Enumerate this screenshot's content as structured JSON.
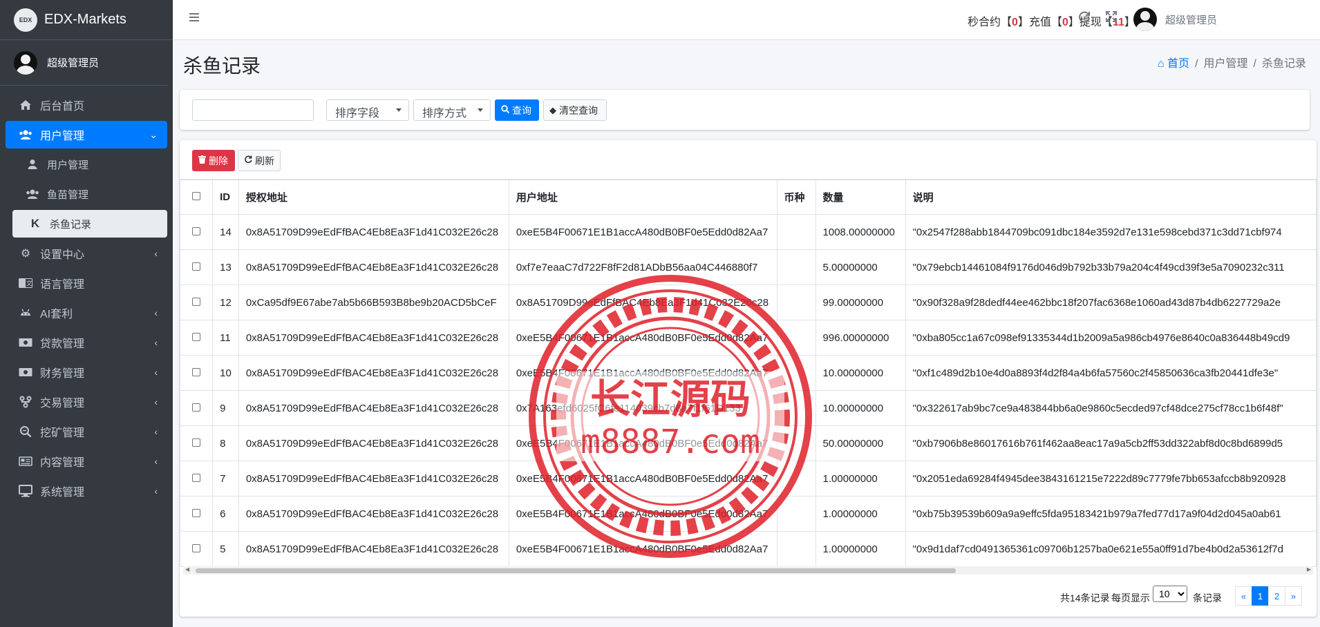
{
  "brand": {
    "logo_text": "EDX",
    "name": "EDX-Markets"
  },
  "sidebar": {
    "user_name": "超级管理员",
    "items": [
      {
        "label": "后台首页",
        "icon": "home-icon"
      },
      {
        "label": "用户管理",
        "icon": "users-icon",
        "active": true
      },
      {
        "label": "用户管理",
        "icon": "user-icon",
        "sub": true
      },
      {
        "label": "鱼苗管理",
        "icon": "users-icon",
        "sub": true
      },
      {
        "label": "杀鱼记录",
        "icon": "k-icon",
        "sub": true,
        "current": true
      },
      {
        "label": "设置中心",
        "icon": "gears-icon"
      },
      {
        "label": "语言管理",
        "icon": "language-icon"
      },
      {
        "label": "AI套利",
        "icon": "android-icon"
      },
      {
        "label": "贷款管理",
        "icon": "money-icon"
      },
      {
        "label": "财务管理",
        "icon": "money-icon"
      },
      {
        "label": "交易管理",
        "icon": "exchange-icon"
      },
      {
        "label": "挖矿管理",
        "icon": "search-icon"
      },
      {
        "label": "内容管理",
        "icon": "newspaper-icon"
      },
      {
        "label": "系统管理",
        "icon": "desktop-icon"
      }
    ]
  },
  "header": {
    "seconds_label": "秒合约",
    "seconds_count": "0",
    "recharge_label": "充值",
    "recharge_count": "0",
    "withdraw_label": "提现",
    "withdraw_count": "11",
    "user_name": "超级管理员"
  },
  "page": {
    "title": "杀鱼记录",
    "breadcrumb": [
      "首页",
      "用户管理",
      "杀鱼记录"
    ]
  },
  "search": {
    "input_value": "",
    "sort_field": "排序字段",
    "sort_order": "排序方式",
    "query_label": "查询",
    "clear_label": "清空查询"
  },
  "toolbar": {
    "delete_label": "删除",
    "refresh_label": "刷新"
  },
  "table": {
    "columns": [
      "ID",
      "授权地址",
      "用户地址",
      "币种",
      "数量",
      "说明"
    ],
    "rows": [
      {
        "id": "14",
        "auth": "0x8A51709D99eEdFfBAC4Eb8Ea3F1d41C032E26c28",
        "user": "0xeE5B4F00671E1B1accA480dB0BF0e5Edd0d82Aa7",
        "coin": "",
        "qty": "1008.00000000",
        "desc": "\"0x2547f288abb1844709bc091dbc184e3592d7e131e598cebd371c3dd71cbf974"
      },
      {
        "id": "13",
        "auth": "0x8A51709D99eEdFfBAC4Eb8Ea3F1d41C032E26c28",
        "user": "0xf7e7eaaC7d722F8fF2d81ADbB56aa04C446880f7",
        "coin": "",
        "qty": "5.00000000",
        "desc": "\"0x79ebcb14461084f9176d046d9b792b33b79a204c4f49cd39f3e5a7090232c311"
      },
      {
        "id": "12",
        "auth": "0xCa95df9E67abe7ab5b66B593B8be9b20ACD5bCeF",
        "user": "0x8A51709D99eEdFfBAC4Eb8Ea3F1d41C032E26c28",
        "coin": "",
        "qty": "99.00000000",
        "desc": "\"0x90f328a9f28dedf44ee462bbc18f207fac6368e1060ad43d87b4db6227729a2e"
      },
      {
        "id": "11",
        "auth": "0x8A51709D99eEdFfBAC4Eb8Ea3F1d41C032E26c28",
        "user": "0xeE5B4F00671E1B1accA480dB0BF0e5Edd0d82Aa7",
        "coin": "",
        "qty": "996.00000000",
        "desc": "\"0xba805cc1a67c098ef91335344d1b2009a5a986cb4976e8640c0a836448b49cd9"
      },
      {
        "id": "10",
        "auth": "0x8A51709D99eEdFfBAC4Eb8Ea3F1d41C032E26c28",
        "user": "0xeE5B4F00671E1B1accA480dB0BF0e5Edd0d82Aa7",
        "coin": "",
        "qty": "10.00000000",
        "desc": "\"0xf1c489d2b10e4d0a8893f4d2f84a4b6fa57560c2f45850636ca3fb20441dfe3e\""
      },
      {
        "id": "9",
        "auth": "0x8A51709D99eEdFfBAC4Eb8Ea3F1d41C032E26c28",
        "user": "0x7A163efd6025fC6fe114039cb7d8a7f1f61D133",
        "coin": "",
        "qty": "10.00000000",
        "desc": "\"0x322617ab9bc7ce9a483844bb6a0e9860c5ecded97cf48dce275cf78cc1b6f48f\""
      },
      {
        "id": "8",
        "auth": "0x8A51709D99eEdFfBAC4Eb8Ea3F1d41C032E26c28",
        "user": "0xeE5B4F00671E1B1accA480dB0BF0e5Edd0d82Aa7",
        "coin": "",
        "qty": "50.00000000",
        "desc": "\"0xb7906b8e86017616b761f462aa8eac17a9a5cb2ff53dd322abf8d0c8bd6899d5"
      },
      {
        "id": "7",
        "auth": "0x8A51709D99eEdFfBAC4Eb8Ea3F1d41C032E26c28",
        "user": "0xeE5B4F00671E1B1accA480dB0BF0e5Edd0d82Aa7",
        "coin": "",
        "qty": "1.00000000",
        "desc": "\"0x2051eda69284f4945dee3843161215e7222d89c7779fe7bb653afccb8b920928"
      },
      {
        "id": "6",
        "auth": "0x8A51709D99eEdFfBAC4Eb8Ea3F1d41C032E26c28",
        "user": "0xeE5B4F00671E1B1accA480dB0BF0e5Edd0d82Aa7",
        "coin": "",
        "qty": "1.00000000",
        "desc": "\"0xb75b39539b609a9a9effc5fda95183421b979a7fed77d17a9f04d2d045a0ab61"
      },
      {
        "id": "5",
        "auth": "0x8A51709D99eEdFfBAC4Eb8Ea3F1d41C032E26c28",
        "user": "0xeE5B4F00671E1B1accA480dB0BF0e5Edd0d82Aa7",
        "coin": "",
        "qty": "1.00000000",
        "desc": "\"0x9d1daf7cd0491365361c09706b1257ba0e621e55a0ff91d7be4b0d2a53612f7d"
      }
    ]
  },
  "pager": {
    "total_text": "共14条记录",
    "per_page_label": "每页显示",
    "per_page_value": "10",
    "records_label": "条记录",
    "prev": "«",
    "pages": [
      "1",
      "2"
    ],
    "next": "»"
  },
  "watermark": {
    "line1": "长江源码",
    "line2": "m8887.com",
    "color": "#e0202a"
  }
}
